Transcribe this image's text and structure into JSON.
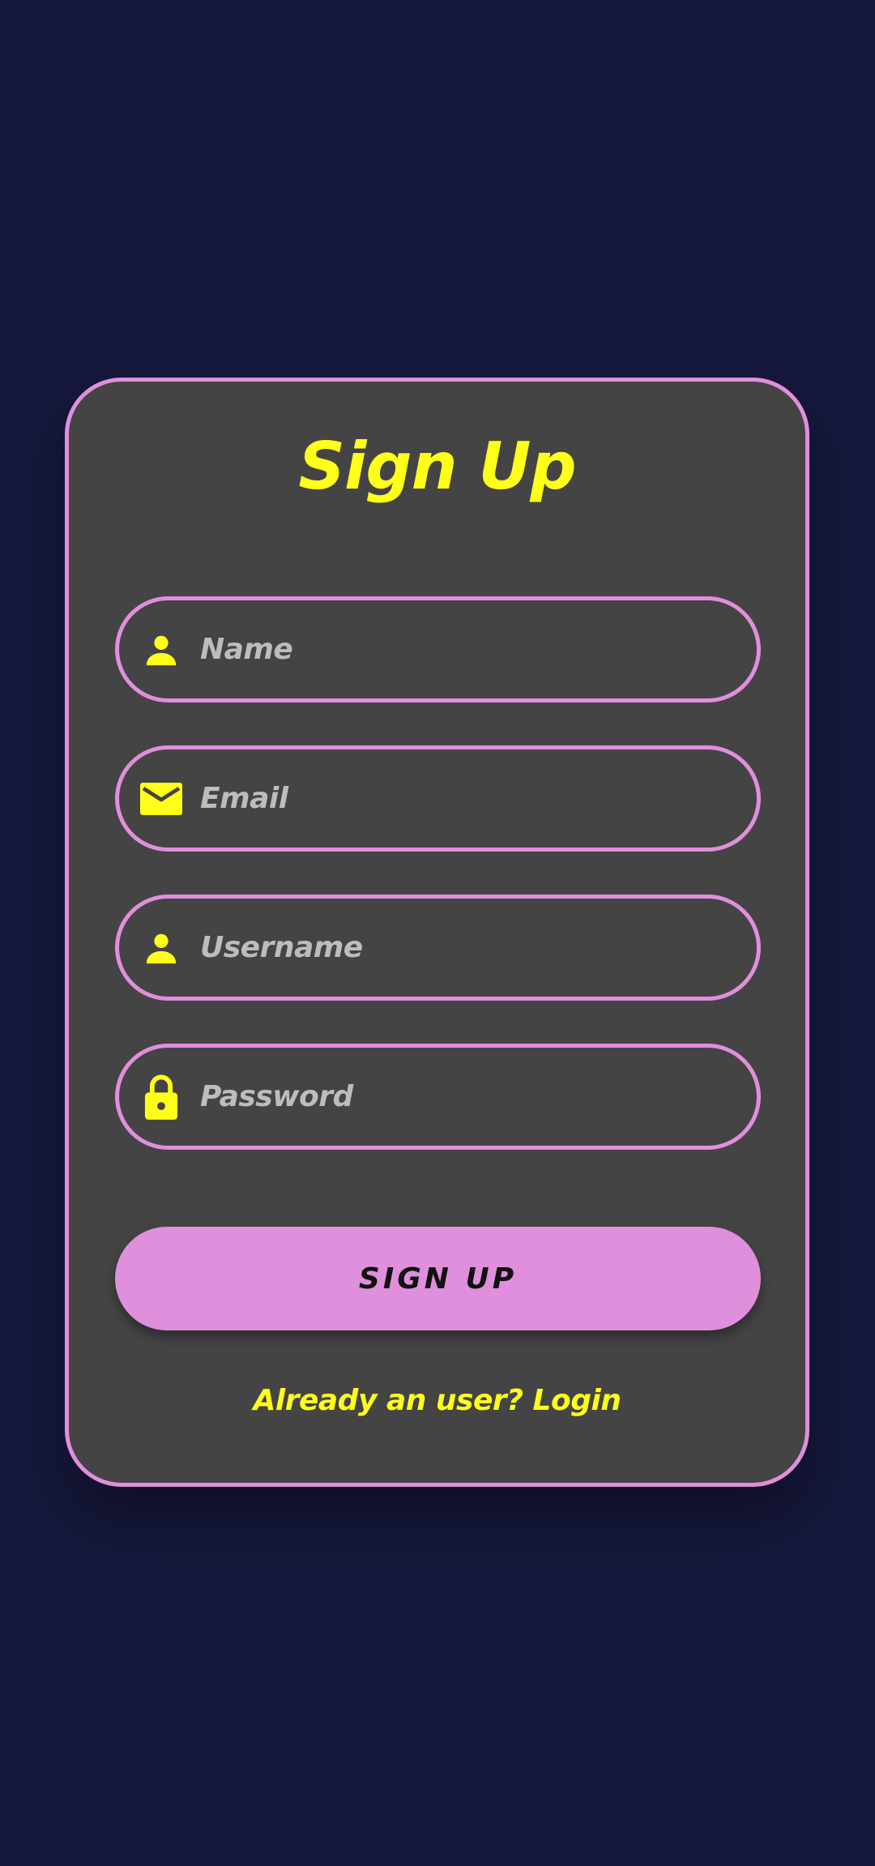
{
  "form": {
    "title": "Sign Up",
    "fields": [
      {
        "icon": "person-icon",
        "placeholder": "Name",
        "value": ""
      },
      {
        "icon": "email-icon",
        "placeholder": "Email",
        "value": ""
      },
      {
        "icon": "person-icon",
        "placeholder": "Username",
        "value": ""
      },
      {
        "icon": "lock-icon",
        "placeholder": "Password",
        "value": ""
      }
    ],
    "submit_label": "SIGN UP",
    "login_link": "Already an user? Login"
  },
  "colors": {
    "background": "#16183c",
    "card": "#444444",
    "accent_border": "#e08fdc",
    "title_text": "#ffff1a",
    "placeholder_text": "#bdbdbd",
    "button_bg": "#e08fdc",
    "button_text": "#111111"
  }
}
